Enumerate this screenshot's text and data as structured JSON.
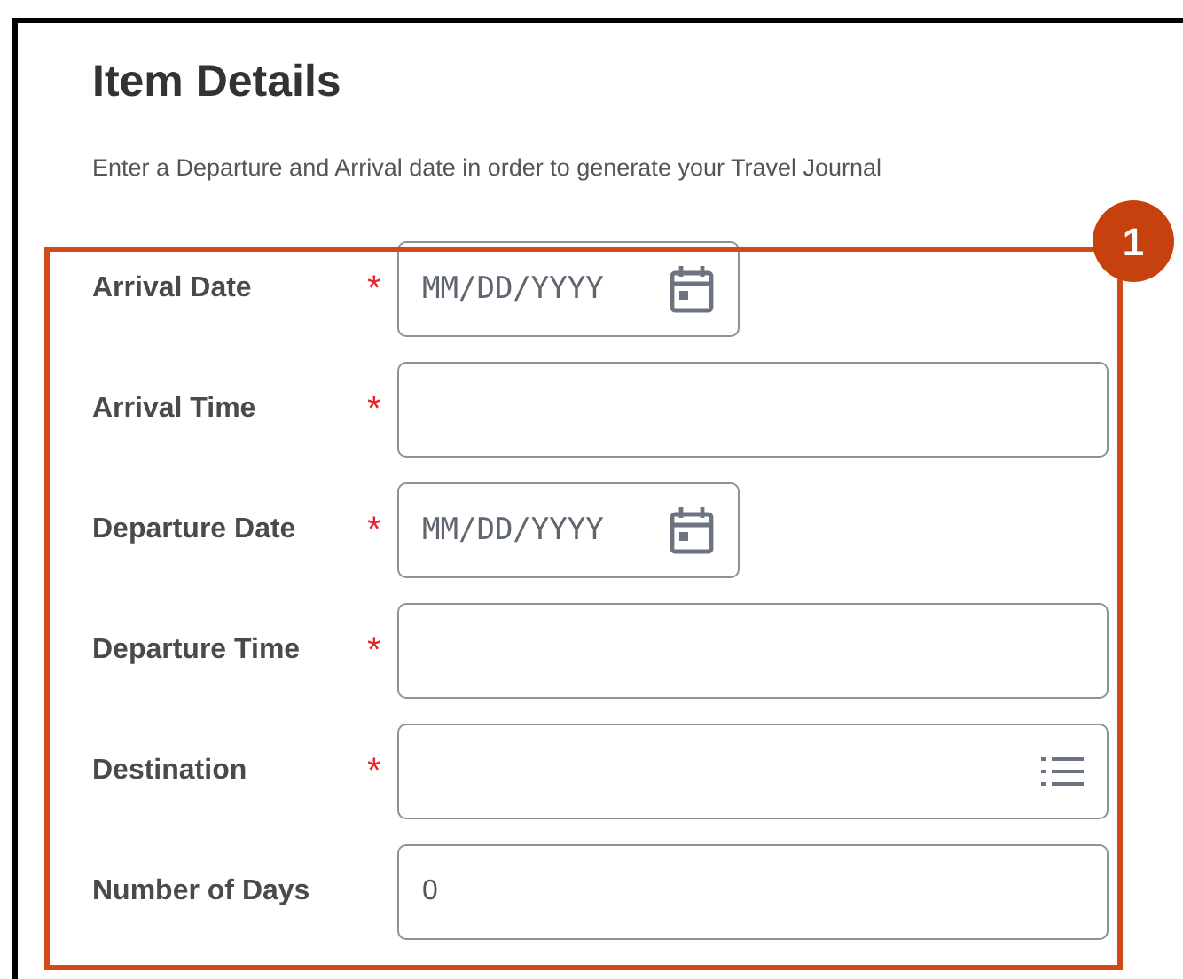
{
  "title": "Item Details",
  "description": "Enter a Departure and Arrival date in order to generate your Travel Journal",
  "callout": {
    "number": "1"
  },
  "fields": [
    {
      "label": "Arrival Date",
      "required_marker": "*",
      "kind": "date",
      "placeholder": "MM/DD/YYYY"
    },
    {
      "label": "Arrival Time",
      "required_marker": "*",
      "kind": "text"
    },
    {
      "label": "Departure Date",
      "required_marker": "*",
      "kind": "date",
      "placeholder": "MM/DD/YYYY"
    },
    {
      "label": "Departure Time",
      "required_marker": "*",
      "kind": "text"
    },
    {
      "label": "Destination",
      "required_marker": "*",
      "kind": "list"
    },
    {
      "label": "Number of Days",
      "kind": "number",
      "value": "0"
    }
  ]
}
